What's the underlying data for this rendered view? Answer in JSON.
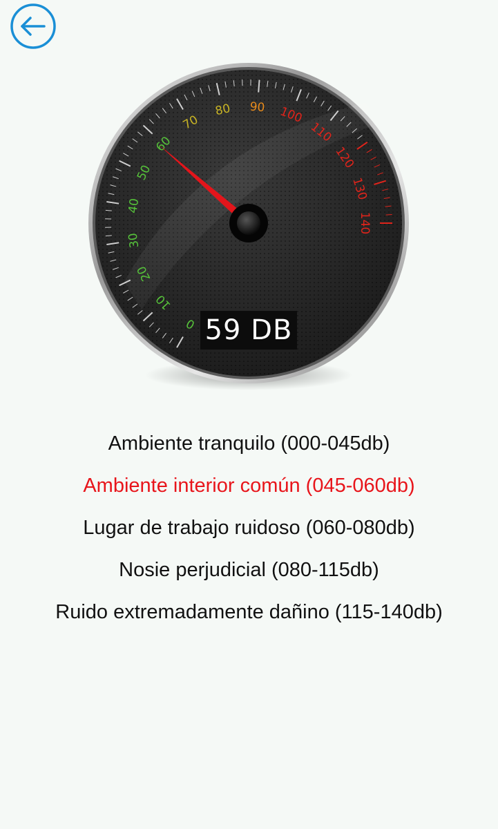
{
  "header": {
    "back_icon": "arrow-left-circle-icon",
    "accent_color": "#1a8fd6"
  },
  "meter": {
    "reading": 59,
    "reading_text": "59 DB",
    "scale_min": 0,
    "scale_max": 140,
    "tick_labels": [
      "0",
      "10",
      "20",
      "30",
      "40",
      "50",
      "60",
      "70",
      "80",
      "90",
      "100",
      "110",
      "120",
      "130",
      "140"
    ],
    "colors": {
      "green": "#56c23a",
      "yellow": "#c7b324",
      "orange": "#e88b1c",
      "red": "#e0241b",
      "needle": "#e3151b",
      "dial": "#2b2b2b",
      "bezel": "#c9c9c9"
    }
  },
  "levels": {
    "active_index": 1,
    "active_color": "#e8151b",
    "items": [
      "Ambiente tranquilo (000-045db)",
      "Ambiente interior común (045-060db)",
      "Lugar de trabajo ruidoso (060-080db)",
      "Nosie perjudicial (080-115db)",
      "Ruido extremadamente dañino (115-140db)"
    ]
  }
}
